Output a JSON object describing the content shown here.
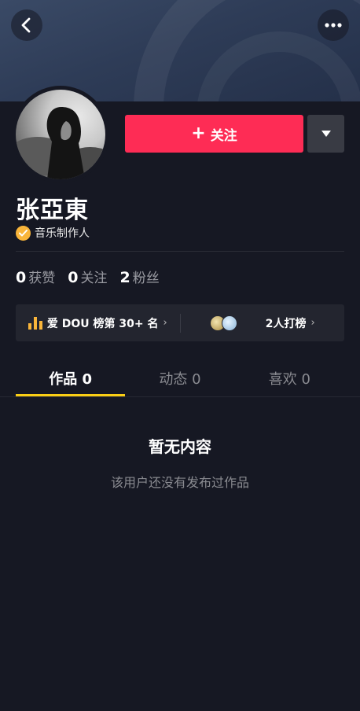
{
  "colors": {
    "background": "#161823",
    "follow": "#fe2c55",
    "tab_indicator": "#face15",
    "verify_badge": "#f9b53a"
  },
  "header": {
    "back_icon": "chevron-left-icon",
    "more_icon": "more-dots-icon"
  },
  "profile": {
    "name": "张亞東",
    "verified_label": "音乐制作人",
    "follow_label": "关注",
    "follow_icon": "plus-icon",
    "dropdown_icon": "triangle-down-icon"
  },
  "stats": [
    {
      "value": "0",
      "label": "获赞"
    },
    {
      "value": "0",
      "label": "关注"
    },
    {
      "value": "2",
      "label": "粉丝"
    }
  ],
  "rank": {
    "left_label": "爱 DOU 榜第 30+ 名",
    "right_label": "2人打榜"
  },
  "tabs": [
    {
      "label": "作品 0"
    },
    {
      "label": "动态 0"
    },
    {
      "label": "喜欢 0"
    }
  ],
  "empty": {
    "title": "暂无内容",
    "subtitle": "该用户还没有发布过作品"
  }
}
